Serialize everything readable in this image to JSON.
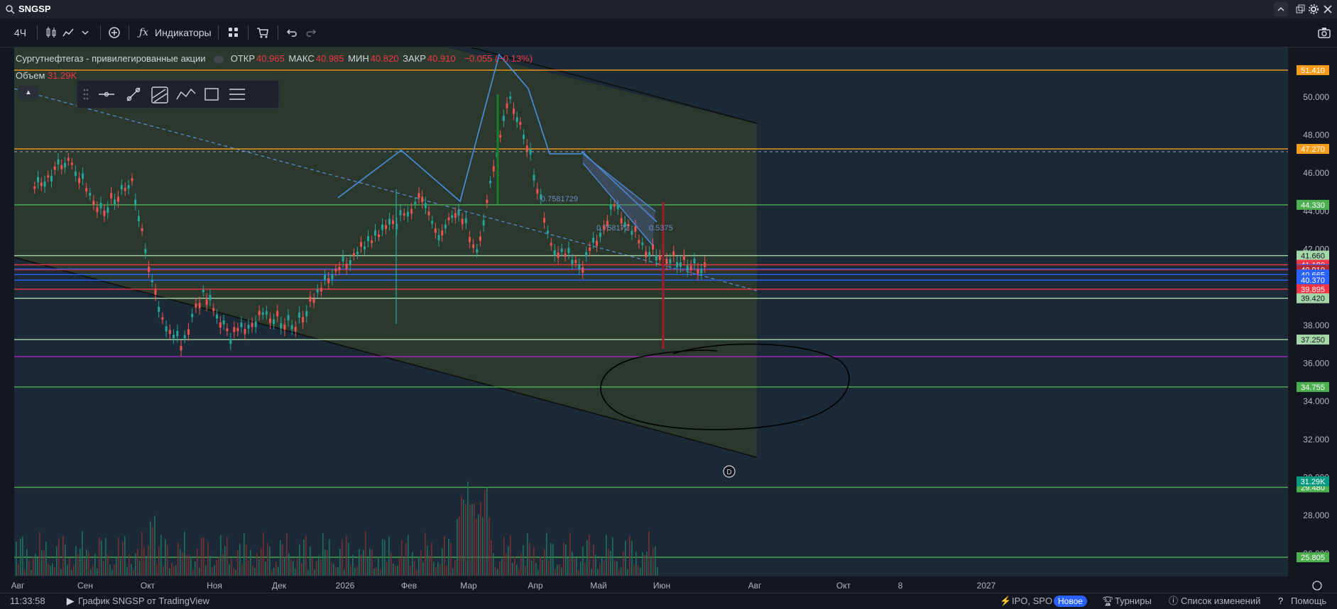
{
  "topbar": {
    "symbol": "SNGSP"
  },
  "toolbar": {
    "interval": "4Ч",
    "indicators_label": "Индикаторы"
  },
  "legend": {
    "name": "Сургутнефтегаз - привилегированные акции",
    "open_label": "ОТКР",
    "open_value": "40.965",
    "high_label": "МАКС",
    "high_value": "40.985",
    "low_label": "МИН",
    "low_value": "40.820",
    "close_label": "ЗАКР",
    "close_value": "40.910",
    "change": "−0.055 (−0.13%)",
    "volume_label": "Объем",
    "volume_value": "31.29K"
  },
  "statusbar": {
    "time": "11:33:58",
    "attribution": "График SNGSP от TradingView",
    "ipo_label": "IPO, SPO",
    "new_badge": "Новое",
    "tournaments": "Турниры",
    "changelog": "Список изменений",
    "help": "Помощь"
  },
  "chart_data": {
    "type": "line",
    "title": "Сургутнефтегаз - привилегированные акции",
    "y_ticks": [
      "50.000",
      "48.000",
      "46.000",
      "44.000",
      "42.000",
      "40.000",
      "38.000",
      "36.000",
      "34.000",
      "32.000",
      "30.000",
      "28.000",
      "26.000"
    ],
    "ylim": [
      24.8,
      52.6
    ],
    "x_ticks": [
      "Авг",
      "Сен",
      "Окт",
      "Ноя",
      "Дек",
      "2026",
      "Фев",
      "Мар",
      "Апр",
      "Май",
      "Июн",
      "Авг",
      "Окт",
      "8",
      "2027"
    ],
    "horizontal_levels": [
      {
        "value": "51.410",
        "color": "#f59c1a"
      },
      {
        "value": "47.270",
        "color": "#f59c1a"
      },
      {
        "value": "44.330",
        "color": "#4caf50"
      },
      {
        "value": "41.660",
        "color": "#a5d6a7"
      },
      {
        "value": "41.180",
        "color": "#f23645"
      },
      {
        "value": "40.950",
        "color": "#2962ff"
      },
      {
        "value": "40.910",
        "color": "#b22833"
      },
      {
        "value": "40.665",
        "color": "#2962ff"
      },
      {
        "value": "40.370",
        "color": "#2962ff"
      },
      {
        "value": "39.895",
        "color": "#f23645"
      },
      {
        "value": "39.420",
        "color": "#a5d6a7"
      },
      {
        "value": "37.250",
        "color": "#a5d6a7"
      },
      {
        "value": "34.755",
        "color": "#4caf50"
      },
      {
        "value": "29.480",
        "color": "#4caf50"
      },
      {
        "value": "25.805",
        "color": "#4caf50"
      }
    ],
    "volume_label_right": "31.29K",
    "price_path": [
      [
        "Авг",
        45.2
      ],
      [
        "Авг",
        46.8
      ],
      [
        "Сен",
        44.0
      ],
      [
        "Сен",
        45.6
      ],
      [
        "Окт",
        38.6
      ],
      [
        "Окт",
        37.0
      ],
      [
        "Окт",
        39.8
      ],
      [
        "Ноя",
        37.4
      ],
      [
        "Ноя",
        38.6
      ],
      [
        "Дек",
        38.0
      ],
      [
        "Дек",
        40.6
      ],
      [
        "2026",
        42.0
      ],
      [
        "2026",
        43.3
      ],
      [
        "Фев",
        44.6
      ],
      [
        "Фев",
        42.9
      ],
      [
        "Фев",
        44.2
      ],
      [
        "Мар",
        41.8
      ],
      [
        "Мар",
        46.5
      ],
      [
        "Мар",
        50.0
      ],
      [
        "Мар",
        47.6
      ],
      [
        "Апр",
        42.2
      ],
      [
        "Апр",
        41.2
      ],
      [
        "Май",
        44.3
      ],
      [
        "Май",
        42.0
      ],
      [
        "Июн",
        40.9
      ]
    ],
    "annotations": [
      "0.7581729",
      "0.758172",
      "0.5375"
    ]
  }
}
